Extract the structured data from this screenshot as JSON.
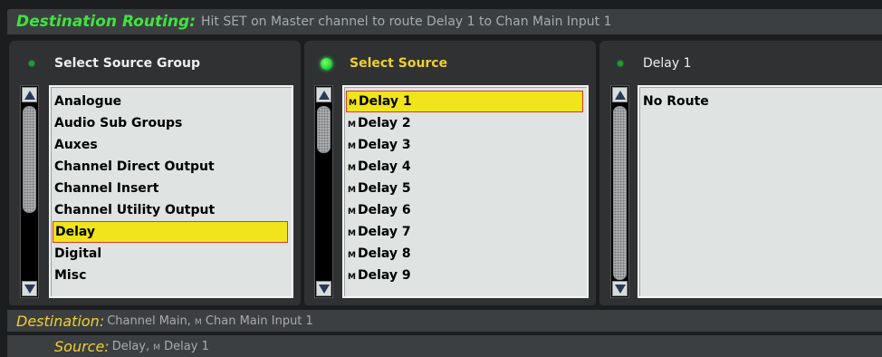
{
  "header": {
    "title": "Destination Routing:",
    "hint": "Hit SET on Master channel to route Delay 1 to Chan Main Input 1"
  },
  "panels": {
    "group": {
      "title": "Select Source Group",
      "items": [
        "Analogue",
        "Audio Sub Groups",
        "Auxes",
        "Channel Direct Output",
        "Channel Insert",
        "Channel Utility Output",
        "Delay",
        "Digital",
        "Misc"
      ],
      "selected": "Delay"
    },
    "source": {
      "title": "Select Source",
      "items": [
        "Delay 1",
        "Delay 2",
        "Delay 3",
        "Delay 4",
        "Delay 5",
        "Delay 6",
        "Delay 7",
        "Delay 8",
        "Delay 9"
      ],
      "item_prefix": "M",
      "selected": "Delay 1"
    },
    "route": {
      "title": "Delay 1",
      "items": [
        "No Route"
      ]
    }
  },
  "destination": {
    "label": "Destination:",
    "value_main": "Channel Main,",
    "prefix": "M",
    "value_input": "Chan Main Input 1"
  },
  "source_bar": {
    "label": "Source:",
    "value_group": "Delay,",
    "prefix": "M",
    "value_item": "Delay 1"
  },
  "colors": {
    "title_green": "#3ee43e",
    "label_yellow": "#f0d030",
    "selection": "#f0e41a",
    "selection_border": "#d83a2a"
  }
}
